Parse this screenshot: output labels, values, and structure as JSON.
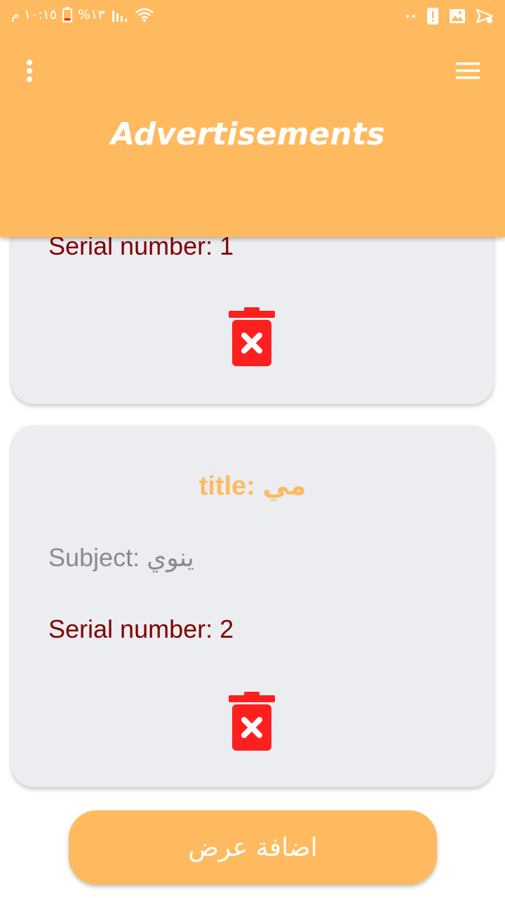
{
  "status_bar": {
    "time": "١٠:١٥ م",
    "battery": "%١٣"
  },
  "header": {
    "title": "Advertisements",
    "left_icon": "more-vert-icon",
    "right_icon": "menu-icon"
  },
  "cards": [
    {
      "serial": "Serial number: 1",
      "delete_icon": "delete-icon"
    },
    {
      "title": "title: مي",
      "subject": "Subject: ينوي",
      "serial": "Serial number: 2",
      "delete_icon": "delete-icon"
    }
  ],
  "add_button": {
    "label": "اضافة عرض"
  },
  "colors": {
    "primary": "#ffba60",
    "card_bg": "#ebedf0",
    "serial_text": "#800000",
    "subject_text": "#888c8f",
    "delete_red": "#ff1f1f"
  }
}
